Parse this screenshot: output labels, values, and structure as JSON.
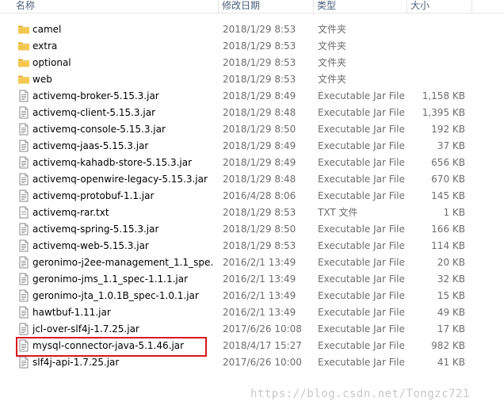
{
  "columns": {
    "name": "名称",
    "date": "修改日期",
    "type": "类型",
    "size": "大小"
  },
  "files": [
    {
      "name": "camel",
      "date": "2018/1/29 8:53",
      "type": "文件夹",
      "size": "",
      "icon": "folder-icon"
    },
    {
      "name": "extra",
      "date": "2018/1/29 8:53",
      "type": "文件夹",
      "size": "",
      "icon": "folder-icon"
    },
    {
      "name": "optional",
      "date": "2018/1/29 8:53",
      "type": "文件夹",
      "size": "",
      "icon": "folder-icon"
    },
    {
      "name": "web",
      "date": "2018/1/29 8:53",
      "type": "文件夹",
      "size": "",
      "icon": "folder-icon"
    },
    {
      "name": "activemq-broker-5.15.3.jar",
      "date": "2018/1/29 8:49",
      "type": "Executable Jar File",
      "size": "1,158 KB",
      "icon": "jar-file-icon"
    },
    {
      "name": "activemq-client-5.15.3.jar",
      "date": "2018/1/29 8:48",
      "type": "Executable Jar File",
      "size": "1,395 KB",
      "icon": "jar-file-icon"
    },
    {
      "name": "activemq-console-5.15.3.jar",
      "date": "2018/1/29 8:50",
      "type": "Executable Jar File",
      "size": "192 KB",
      "icon": "jar-file-icon"
    },
    {
      "name": "activemq-jaas-5.15.3.jar",
      "date": "2018/1/29 8:49",
      "type": "Executable Jar File",
      "size": "37 KB",
      "icon": "jar-file-icon"
    },
    {
      "name": "activemq-kahadb-store-5.15.3.jar",
      "date": "2018/1/29 8:49",
      "type": "Executable Jar File",
      "size": "656 KB",
      "icon": "jar-file-icon"
    },
    {
      "name": "activemq-openwire-legacy-5.15.3.jar",
      "date": "2018/1/29 8:48",
      "type": "Executable Jar File",
      "size": "670 KB",
      "icon": "jar-file-icon"
    },
    {
      "name": "activemq-protobuf-1.1.jar",
      "date": "2016/4/28 8:06",
      "type": "Executable Jar File",
      "size": "145 KB",
      "icon": "jar-file-icon"
    },
    {
      "name": "activemq-rar.txt",
      "date": "2018/1/29 8:53",
      "type": "TXT 文件",
      "size": "1 KB",
      "icon": "text-file-icon"
    },
    {
      "name": "activemq-spring-5.15.3.jar",
      "date": "2018/1/29 8:50",
      "type": "Executable Jar File",
      "size": "166 KB",
      "icon": "jar-file-icon"
    },
    {
      "name": "activemq-web-5.15.3.jar",
      "date": "2018/1/29 8:53",
      "type": "Executable Jar File",
      "size": "114 KB",
      "icon": "jar-file-icon"
    },
    {
      "name": "geronimo-j2ee-management_1.1_spe...",
      "date": "2016/2/1 13:49",
      "type": "Executable Jar File",
      "size": "20 KB",
      "icon": "jar-file-icon"
    },
    {
      "name": "geronimo-jms_1.1_spec-1.1.1.jar",
      "date": "2016/2/1 13:49",
      "type": "Executable Jar File",
      "size": "32 KB",
      "icon": "jar-file-icon"
    },
    {
      "name": "geronimo-jta_1.0.1B_spec-1.0.1.jar",
      "date": "2016/2/1 13:49",
      "type": "Executable Jar File",
      "size": "15 KB",
      "icon": "jar-file-icon"
    },
    {
      "name": "hawtbuf-1.11.jar",
      "date": "2016/2/1 13:49",
      "type": "Executable Jar File",
      "size": "49 KB",
      "icon": "jar-file-icon"
    },
    {
      "name": "jcl-over-slf4j-1.7.25.jar",
      "date": "2017/6/26 10:08",
      "type": "Executable Jar File",
      "size": "17 KB",
      "icon": "jar-file-icon"
    },
    {
      "name": "mysql-connector-java-5.1.46.jar",
      "date": "2018/4/17 15:27",
      "type": "Executable Jar File",
      "size": "982 KB",
      "icon": "jar-file-icon"
    },
    {
      "name": "slf4j-api-1.7.25.jar",
      "date": "2017/6/26 10:00",
      "type": "Executable Jar File",
      "size": "41 KB",
      "icon": "jar-file-icon"
    }
  ],
  "highlighted_file": "mysql-connector-java-5.1.46.jar",
  "watermark": "https://blog.csdn.net/Tongzc721",
  "colors": {
    "folder": "#f4c74f",
    "highlight": "#d9161c",
    "header_text": "#4c607a"
  }
}
